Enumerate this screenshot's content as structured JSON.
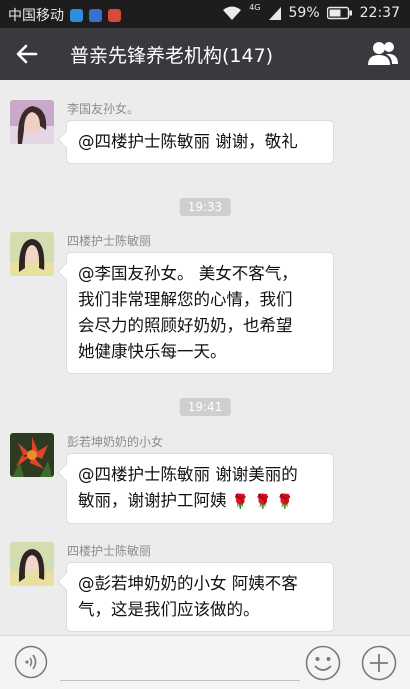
{
  "status_bar": {
    "carrier": "中国移动",
    "network_type": "4G",
    "battery_percent": "59%",
    "time": "22:37"
  },
  "header": {
    "title": "普亲先锋养老机构(147)"
  },
  "messages": [
    {
      "sender": "李国友孙女。",
      "text": "@四楼护士陈敏丽 谢谢，敬礼"
    },
    {
      "time": "19:33",
      "sender": "四楼护士陈敏丽",
      "lines": [
        "@李国友孙女。 美女不客气，",
        "我们非常理解您的心情，我们",
        "会尽力的照顾好奶奶，也希望",
        "她健康快乐每一天。"
      ]
    },
    {
      "time": "19:41",
      "sender": "彭若坤奶奶的小女",
      "lines": [
        "@四楼护士陈敏丽 谢谢美丽的",
        "敏丽，谢谢护工阿姨"
      ]
    },
    {
      "sender": "四楼护士陈敏丽",
      "lines": [
        "@彭若坤奶奶的小女 阿姨不客",
        "气，这是我们应该做的。"
      ]
    }
  ],
  "colors": {
    "status_bar": "#1d1d1d",
    "title_bar": "#393a3f",
    "chat_background": "#ececec",
    "bubble": "#ffffff"
  }
}
